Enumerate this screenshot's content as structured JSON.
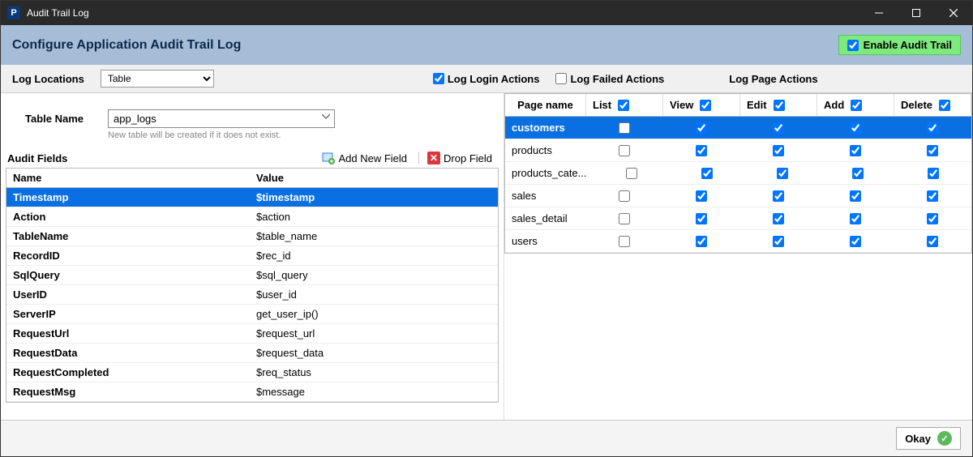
{
  "window": {
    "title": "Audit Trail Log"
  },
  "header": {
    "title": "Configure Application Audit Trail Log",
    "enable_label": "Enable Audit Trail",
    "enable_checked": true
  },
  "toolbar": {
    "log_locations_label": "Log Locations",
    "log_locations_value": "Table",
    "log_login_label": "Log Login Actions",
    "log_login_checked": true,
    "log_failed_label": "Log Failed Actions",
    "log_failed_checked": false,
    "log_page_label": "Log Page Actions"
  },
  "table_name": {
    "label": "Table Name",
    "value": "app_logs",
    "hint": "New table will be created if it does not exist."
  },
  "audit_fields": {
    "title": "Audit Fields",
    "add_label": "Add New Field",
    "drop_label": "Drop Field",
    "cols": {
      "name": "Name",
      "value": "Value"
    },
    "rows": [
      {
        "name": "Timestamp",
        "value": "$timestamp",
        "selected": true
      },
      {
        "name": "Action",
        "value": "$action"
      },
      {
        "name": "TableName",
        "value": "$table_name"
      },
      {
        "name": "RecordID",
        "value": "$rec_id"
      },
      {
        "name": "SqlQuery",
        "value": "$sql_query"
      },
      {
        "name": "UserID",
        "value": "$user_id"
      },
      {
        "name": "ServerIP",
        "value": "get_user_ip()"
      },
      {
        "name": "RequestUrl",
        "value": "$request_url"
      },
      {
        "name": "RequestData",
        "value": "$request_data"
      },
      {
        "name": "RequestCompleted",
        "value": "$req_status"
      },
      {
        "name": "RequestMsg",
        "value": "$message"
      }
    ]
  },
  "page_actions": {
    "columns": [
      {
        "key": "page",
        "label": "Page name"
      },
      {
        "key": "list",
        "label": "List",
        "header_checked": true
      },
      {
        "key": "view",
        "label": "View",
        "header_checked": true
      },
      {
        "key": "edit",
        "label": "Edit",
        "header_checked": true
      },
      {
        "key": "add",
        "label": "Add",
        "header_checked": true
      },
      {
        "key": "delete",
        "label": "Delete",
        "header_checked": true
      }
    ],
    "rows": [
      {
        "page": "customers",
        "list": false,
        "view": true,
        "edit": true,
        "add": true,
        "delete": true,
        "selected": true
      },
      {
        "page": "products",
        "list": false,
        "view": true,
        "edit": true,
        "add": true,
        "delete": true
      },
      {
        "page": "products_cate...",
        "list": false,
        "view": true,
        "edit": true,
        "add": true,
        "delete": true
      },
      {
        "page": "sales",
        "list": false,
        "view": true,
        "edit": true,
        "add": true,
        "delete": true
      },
      {
        "page": "sales_detail",
        "list": false,
        "view": true,
        "edit": true,
        "add": true,
        "delete": true
      },
      {
        "page": "users",
        "list": false,
        "view": true,
        "edit": true,
        "add": true,
        "delete": true
      }
    ]
  },
  "footer": {
    "ok_label": "Okay"
  }
}
